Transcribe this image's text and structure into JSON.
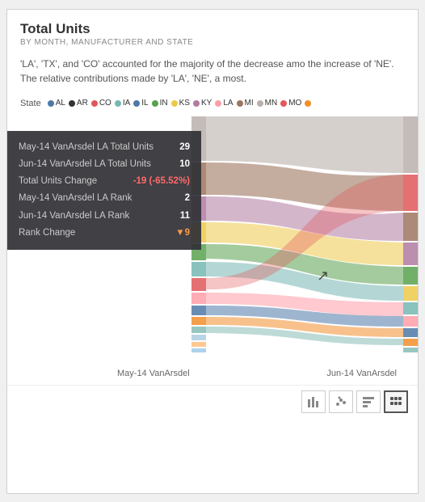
{
  "card": {
    "title": "Total Units",
    "subtitle": "BY MONTH, MANUFACTURER AND STATE",
    "description": "'LA', 'TX', and 'CO' accounted for the majority of the decrease amo the increase of 'NE'. The relative contributions made by 'LA', 'NE', a most."
  },
  "legend": {
    "state_label": "State",
    "items": [
      {
        "label": "AL",
        "color": "#4e79a7"
      },
      {
        "label": "AR",
        "color": "#333333"
      },
      {
        "label": "CO",
        "color": "#e15759"
      },
      {
        "label": "IA",
        "color": "#76b7b2"
      },
      {
        "label": "IL",
        "color": "#4e79a7"
      },
      {
        "label": "IN",
        "color": "#59a14f"
      },
      {
        "label": "KS",
        "color": "#edc948"
      },
      {
        "label": "KY",
        "color": "#b07aa1"
      },
      {
        "label": "LA",
        "color": "#ff9da7"
      },
      {
        "label": "MI",
        "color": "#9c755f"
      },
      {
        "label": "MN",
        "color": "#bab0ac"
      },
      {
        "label": "MO",
        "color": "#e15759"
      }
    ]
  },
  "tooltip": {
    "rows": [
      {
        "key": "May-14 VanArsdel LA Total Units",
        "value": "29",
        "type": "normal"
      },
      {
        "key": "Jun-14 VanArsdel LA Total Units",
        "value": "10",
        "type": "normal"
      },
      {
        "key": "Total Units Change",
        "value": "-19 (-65.52%)",
        "type": "negative"
      },
      {
        "key": "May-14 VanArsdel LA Rank",
        "value": "2",
        "type": "normal"
      },
      {
        "key": "Jun-14 VanArsdel LA Rank",
        "value": "11",
        "type": "normal"
      },
      {
        "key": "Rank Change",
        "value": "▼9",
        "type": "rank"
      }
    ]
  },
  "chart_labels": {
    "left": "May-14 VanArsdel",
    "right": "Jun-14 VanArsdel"
  },
  "toolbar": {
    "buttons": [
      {
        "icon": "📊",
        "label": "bar-chart-icon",
        "active": false
      },
      {
        "icon": "⠿",
        "label": "scatter-icon",
        "active": false
      },
      {
        "icon": "▦",
        "label": "column-chart-icon",
        "active": false
      },
      {
        "icon": "⊞",
        "label": "sankey-icon",
        "active": true
      }
    ]
  },
  "colors": {
    "sankey_bands": [
      "#4e79a7",
      "#f28e2b",
      "#e15759",
      "#76b7b2",
      "#59a14f",
      "#edc948",
      "#b07aa1",
      "#ff9da7",
      "#9c755f",
      "#bab0ac",
      "#86bcb6",
      "#e15759",
      "#aecde1",
      "#ffbe7d",
      "#a0cbe8"
    ]
  }
}
